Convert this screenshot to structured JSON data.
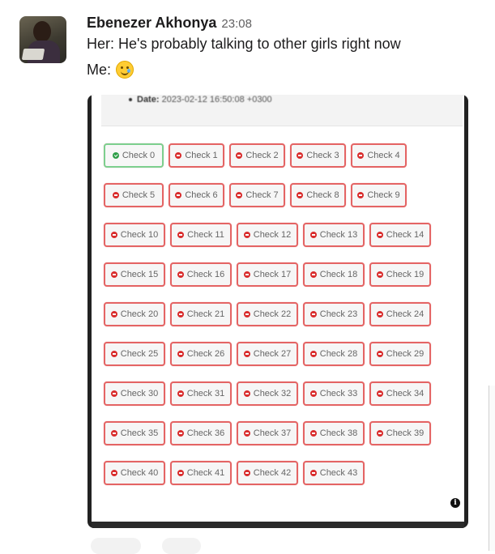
{
  "message": {
    "author": "Ebenezer Akhonya",
    "time": "23:08",
    "line1": "Her: He's probably talking to other girls right now",
    "line2_prefix": "Me:",
    "emoji": "smiling-face-with-tear"
  },
  "attachment": {
    "date_label": "Date:",
    "date_value": "2023-02-12 16:50:08 +0300",
    "checks": [
      {
        "label": "Check 0",
        "status": "pass"
      },
      {
        "label": "Check 1",
        "status": "fail"
      },
      {
        "label": "Check 2",
        "status": "fail"
      },
      {
        "label": "Check 3",
        "status": "fail"
      },
      {
        "label": "Check 4",
        "status": "fail"
      },
      {
        "label": "Check 5",
        "status": "fail"
      },
      {
        "label": "Check 6",
        "status": "fail"
      },
      {
        "label": "Check 7",
        "status": "fail"
      },
      {
        "label": "Check 8",
        "status": "fail"
      },
      {
        "label": "Check 9",
        "status": "fail"
      },
      {
        "label": "Check 10",
        "status": "fail"
      },
      {
        "label": "Check 11",
        "status": "fail"
      },
      {
        "label": "Check 12",
        "status": "fail"
      },
      {
        "label": "Check 13",
        "status": "fail"
      },
      {
        "label": "Check 14",
        "status": "fail"
      },
      {
        "label": "Check 15",
        "status": "fail"
      },
      {
        "label": "Check 16",
        "status": "fail"
      },
      {
        "label": "Check 17",
        "status": "fail"
      },
      {
        "label": "Check 18",
        "status": "fail"
      },
      {
        "label": "Check 19",
        "status": "fail"
      },
      {
        "label": "Check 20",
        "status": "fail"
      },
      {
        "label": "Check 21",
        "status": "fail"
      },
      {
        "label": "Check 22",
        "status": "fail"
      },
      {
        "label": "Check 23",
        "status": "fail"
      },
      {
        "label": "Check 24",
        "status": "fail"
      },
      {
        "label": "Check 25",
        "status": "fail"
      },
      {
        "label": "Check 26",
        "status": "fail"
      },
      {
        "label": "Check 27",
        "status": "fail"
      },
      {
        "label": "Check 28",
        "status": "fail"
      },
      {
        "label": "Check 29",
        "status": "fail"
      },
      {
        "label": "Check 30",
        "status": "fail"
      },
      {
        "label": "Check 31",
        "status": "fail"
      },
      {
        "label": "Check 32",
        "status": "fail"
      },
      {
        "label": "Check 33",
        "status": "fail"
      },
      {
        "label": "Check 34",
        "status": "fail"
      },
      {
        "label": "Check 35",
        "status": "fail"
      },
      {
        "label": "Check 36",
        "status": "fail"
      },
      {
        "label": "Check 37",
        "status": "fail"
      },
      {
        "label": "Check 38",
        "status": "fail"
      },
      {
        "label": "Check 39",
        "status": "fail"
      },
      {
        "label": "Check 40",
        "status": "fail"
      },
      {
        "label": "Check 41",
        "status": "fail"
      },
      {
        "label": "Check 42",
        "status": "fail"
      },
      {
        "label": "Check 43",
        "status": "fail"
      }
    ],
    "colors": {
      "pass": "#2e9e48",
      "fail": "#d92c2c"
    }
  }
}
